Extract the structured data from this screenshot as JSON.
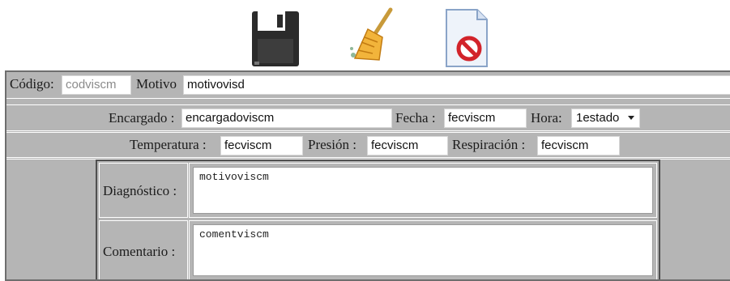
{
  "toolbar": {
    "save_icon": "floppy-disk-icon",
    "clear_icon": "broom-icon",
    "cancel_icon": "document-cancel-icon"
  },
  "form": {
    "codigo_label": "Código:",
    "codigo_placeholder": "codviscm",
    "motivo_label": "Motivo",
    "motivo_value": "motivovisd",
    "encargado_label": "Encargado :",
    "encargado_value": "encargadoviscm",
    "fecha_label": "Fecha :",
    "fecha_value": "fecviscm",
    "hora_label": "Hora:",
    "hora_selected": "1estado",
    "temperatura_label": "Temperatura :",
    "temperatura_value": "fecviscm",
    "presion_label": "Presión :",
    "presion_value": "fecviscm",
    "respiracion_label": "Respiración :",
    "respiracion_value": "fecviscm",
    "diagnostico_label": "Diagnóstico :",
    "diagnostico_value": "motivoviscm",
    "comentario_label": "Comentario :",
    "comentario_value": "comentviscm"
  },
  "colors": {
    "panel_bg": "#b5b5b5",
    "border_dark": "#4f4f4f"
  }
}
